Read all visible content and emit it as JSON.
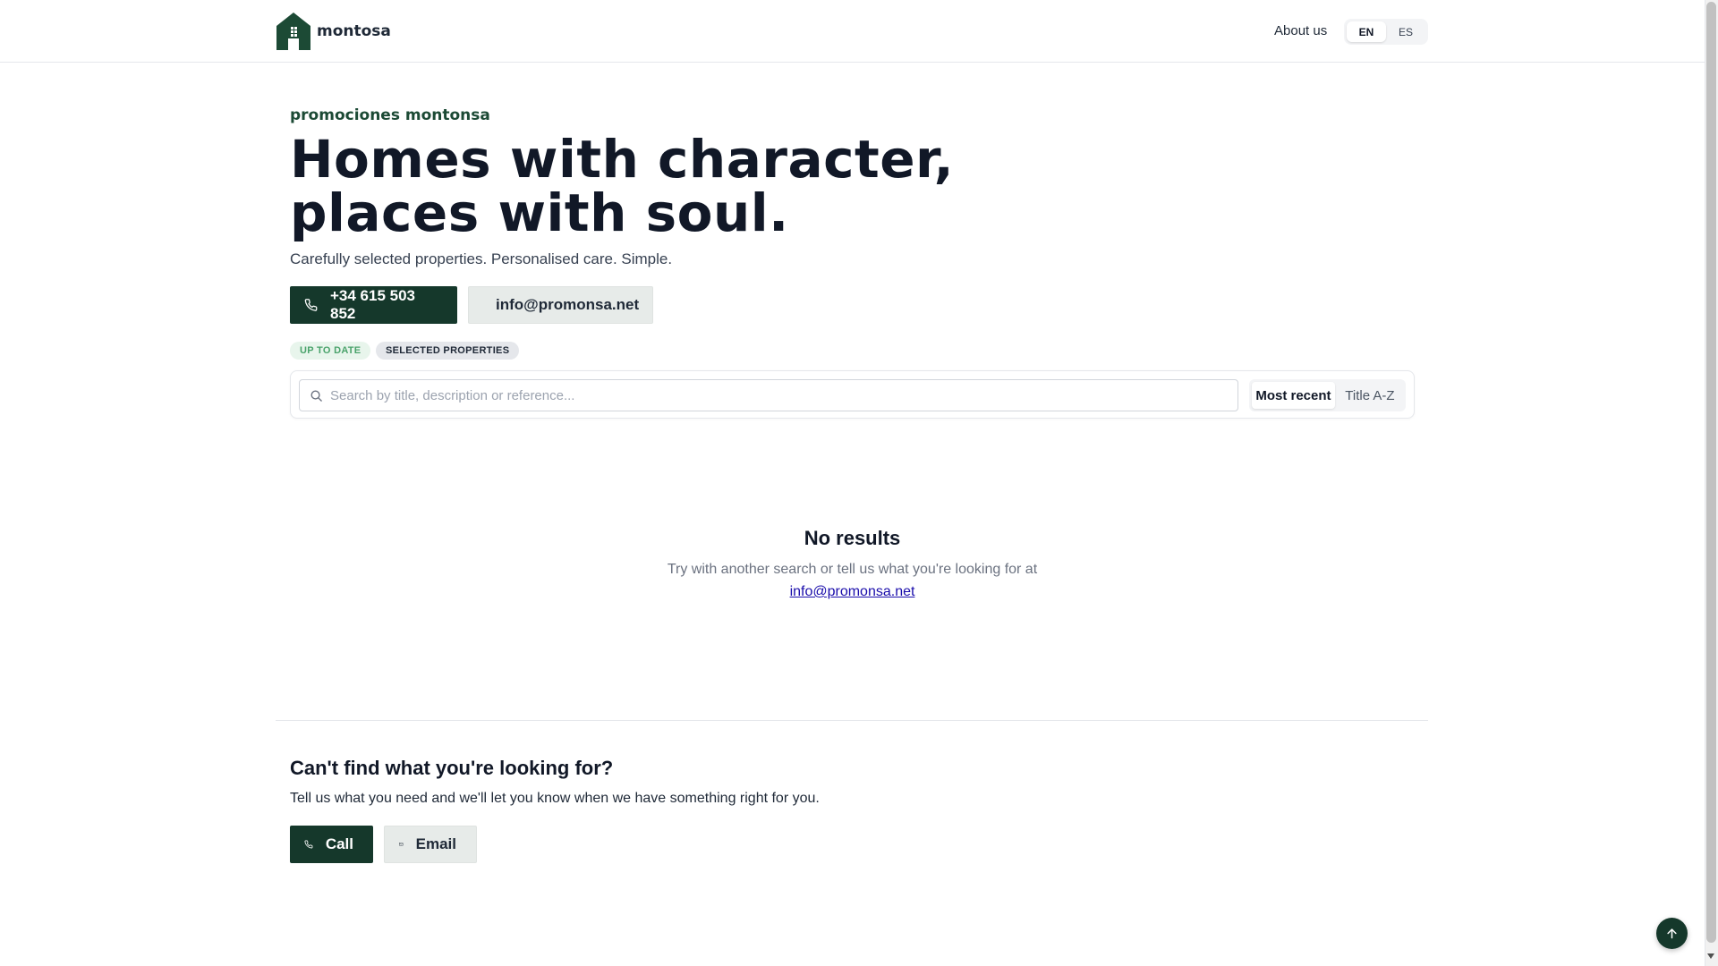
{
  "header": {
    "brand": "montosa",
    "about_label": "About us",
    "languages": [
      "EN",
      "ES"
    ],
    "active_language": "EN"
  },
  "hero": {
    "eyebrow": "promociones montonsa",
    "title_line1": "Homes with character,",
    "title_line2": "places with soul.",
    "subtitle": "Carefully selected properties. Personalised care. Simple.",
    "phone_label": "+34 615 503 852",
    "email_label": "info@promonsa.net",
    "tags": [
      "UP TO DATE",
      "SELECTED PROPERTIES"
    ]
  },
  "search": {
    "placeholder": "Search by title, description or reference...",
    "value": "",
    "sort_options": [
      "Most recent",
      "Title A-Z"
    ],
    "active_sort": "Most recent"
  },
  "results": {
    "empty_title": "No results",
    "empty_text": "Try with another search or tell us what you're looking for at",
    "empty_email": "info@promonsa.net"
  },
  "cta": {
    "title": "Can't find what you're looking for?",
    "text": "Tell us what you need and we'll let you know when we have something right for you.",
    "call_label": "Call",
    "email_label": "Email"
  },
  "icons": {
    "logo": "house-logo-icon",
    "phone": "phone-icon",
    "mail": "mail-icon",
    "search": "search-icon",
    "scroll_top": "arrow-up-icon"
  },
  "colors": {
    "brand_dark": "#15382b",
    "eyebrow": "#1c4a35",
    "tag_green_bg": "#e8f5ec",
    "tag_green_text": "#4aa36b",
    "link": "#1a0dab"
  }
}
